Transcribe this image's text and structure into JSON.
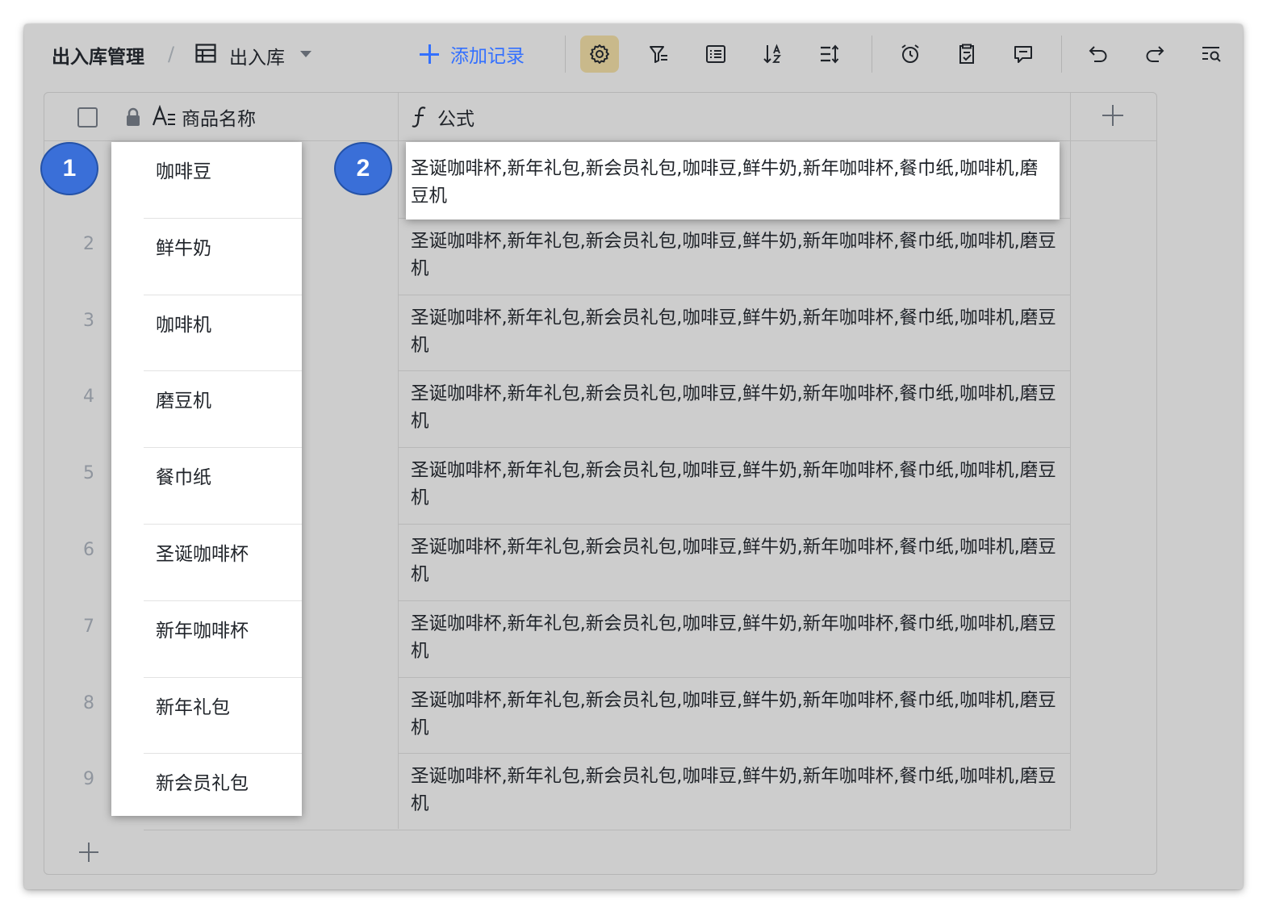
{
  "toolbar": {
    "breadcrumb_base": "出入库管理",
    "separator": "/",
    "view_name": "出入库",
    "add_record_label": "添加记录",
    "accent_color": "#3370ff",
    "icons": [
      "settings-icon",
      "filter-icon",
      "group-icon",
      "sort-icon",
      "row-height-icon",
      "automation-icon",
      "form-icon",
      "comment-icon",
      "undo-icon",
      "redo-icon",
      "search-icon"
    ]
  },
  "table": {
    "columns": [
      {
        "title": "商品名称",
        "type_icon": "text-type-icon",
        "locked": true
      },
      {
        "title": "公式",
        "type_icon": "formula-icon"
      }
    ],
    "rows": [
      {
        "num": "1",
        "name": "咖啡豆",
        "formula": "圣诞咖啡杯,新年礼包,新会员礼包,咖啡豆,鲜牛奶,新年咖啡杯,餐巾纸,咖啡机,磨豆机"
      },
      {
        "num": "2",
        "name": "鲜牛奶",
        "formula": "圣诞咖啡杯,新年礼包,新会员礼包,咖啡豆,鲜牛奶,新年咖啡杯,餐巾纸,咖啡机,磨豆机"
      },
      {
        "num": "3",
        "name": "咖啡机",
        "formula": "圣诞咖啡杯,新年礼包,新会员礼包,咖啡豆,鲜牛奶,新年咖啡杯,餐巾纸,咖啡机,磨豆机"
      },
      {
        "num": "4",
        "name": "磨豆机",
        "formula": "圣诞咖啡杯,新年礼包,新会员礼包,咖啡豆,鲜牛奶,新年咖啡杯,餐巾纸,咖啡机,磨豆机"
      },
      {
        "num": "5",
        "name": "餐巾纸",
        "formula": "圣诞咖啡杯,新年礼包,新会员礼包,咖啡豆,鲜牛奶,新年咖啡杯,餐巾纸,咖啡机,磨豆机"
      },
      {
        "num": "6",
        "name": "圣诞咖啡杯",
        "formula": "圣诞咖啡杯,新年礼包,新会员礼包,咖啡豆,鲜牛奶,新年咖啡杯,餐巾纸,咖啡机,磨豆机"
      },
      {
        "num": "7",
        "name": "新年咖啡杯",
        "formula": "圣诞咖啡杯,新年礼包,新会员礼包,咖啡豆,鲜牛奶,新年咖啡杯,餐巾纸,咖啡机,磨豆机"
      },
      {
        "num": "8",
        "name": "新年礼包",
        "formula": "圣诞咖啡杯,新年礼包,新会员礼包,咖啡豆,鲜牛奶,新年咖啡杯,餐巾纸,咖啡机,磨豆机"
      },
      {
        "num": "9",
        "name": "新会员礼包",
        "formula": "圣诞咖啡杯,新年礼包,新会员礼包,咖啡豆,鲜牛奶,新年咖啡杯,餐巾纸,咖啡机,磨豆机"
      }
    ]
  },
  "annotations": {
    "badge_1": "1",
    "badge_2": "2",
    "badge_color": "#3a6fd8"
  }
}
